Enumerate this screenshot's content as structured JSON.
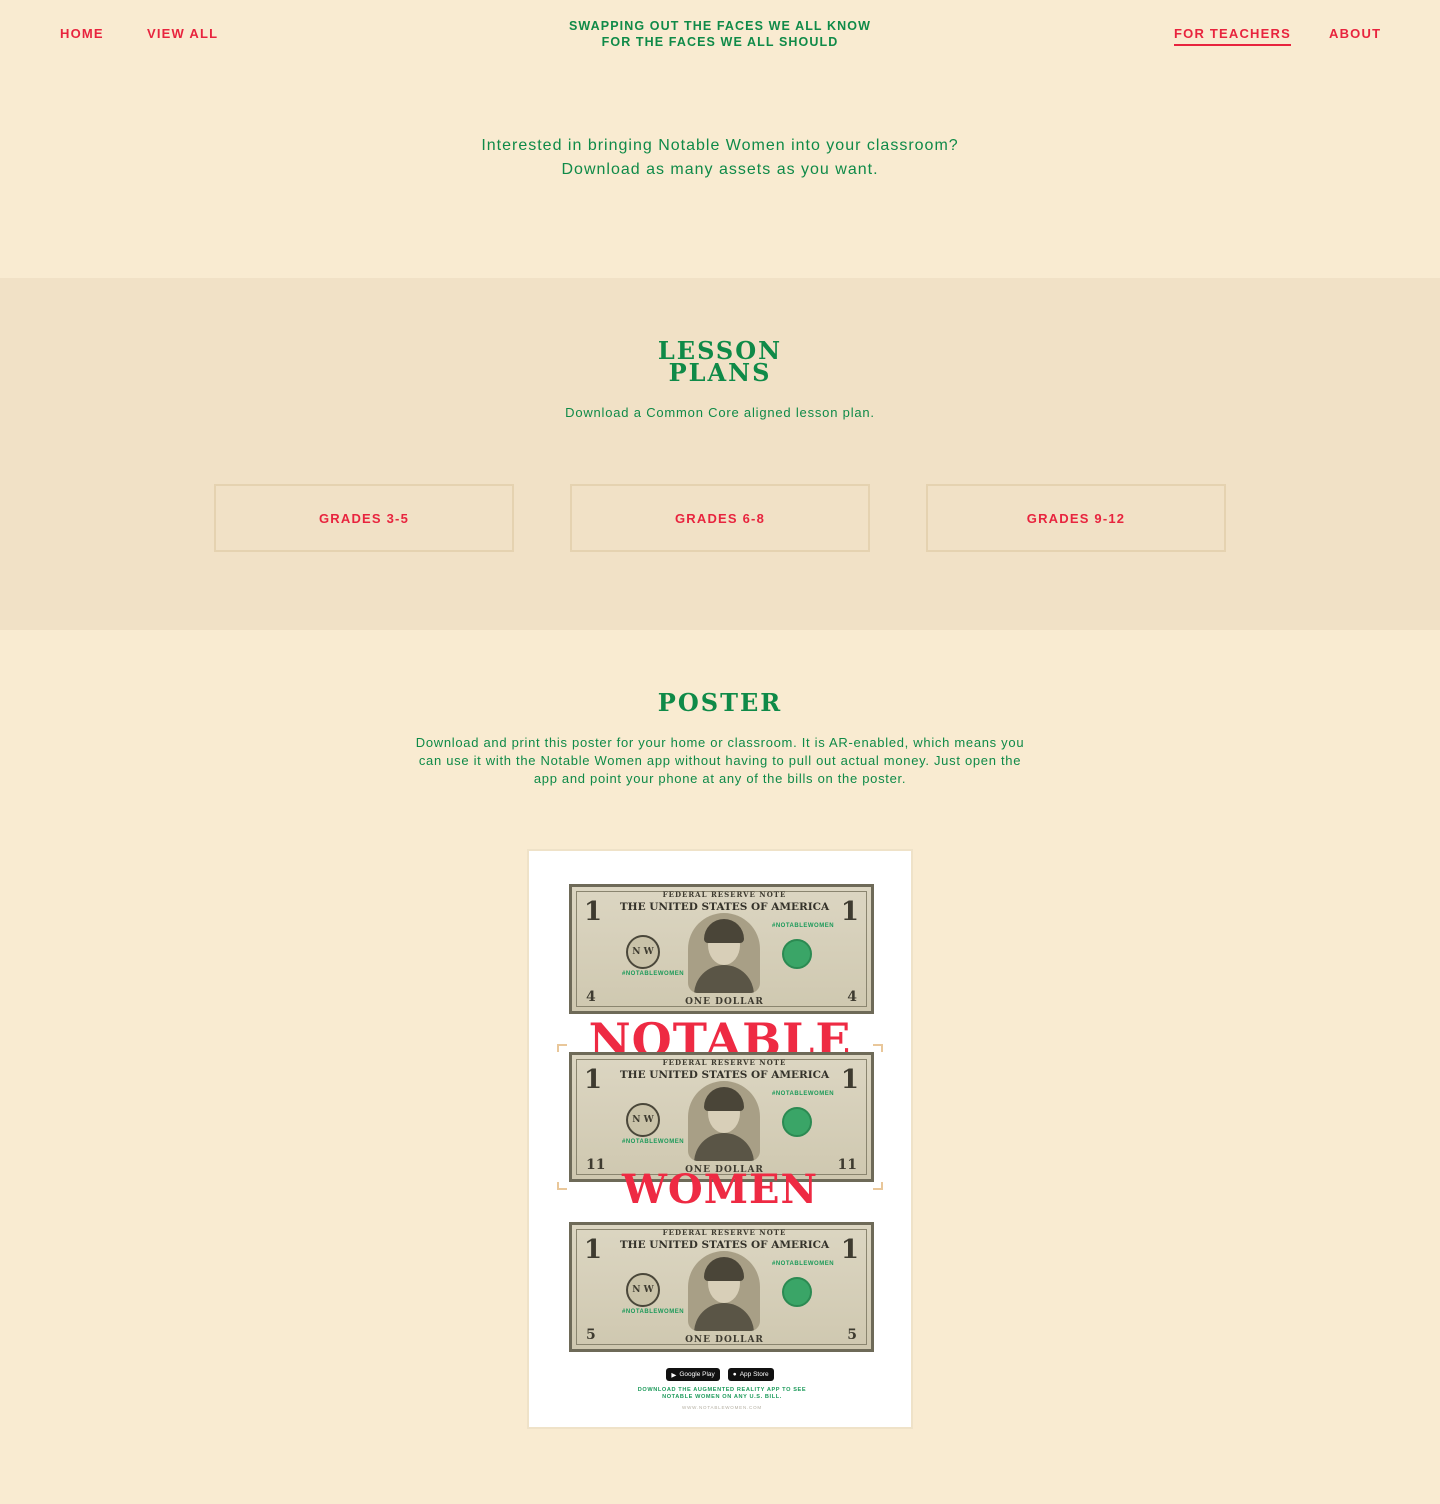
{
  "nav": {
    "home": "HOME",
    "view_all": "VIEW ALL",
    "tagline_line1": "SWAPPING OUT THE FACES WE ALL KNOW",
    "tagline_line2": "FOR THE FACES WE ALL SHOULD",
    "for_teachers": "FOR TEACHERS",
    "about": "ABOUT",
    "active": "FOR TEACHERS"
  },
  "intro": {
    "line1": "Interested in bringing Notable Women into your classroom?",
    "line2": "Download as many assets as you want."
  },
  "lesson_plans": {
    "heading_line1": "LESSON",
    "heading_line2": "PLANS",
    "subtitle": "Download a Common Core aligned lesson plan.",
    "buttons": [
      "GRADES 3-5",
      "GRADES 6-8",
      "GRADES 9-12"
    ]
  },
  "poster": {
    "heading": "POSTER",
    "description_line1": "Download and print this poster for your home or classroom. It is AR-enabled, which means you",
    "description_line2": "can use it with the Notable Women app without having to pull out actual money. Just open the",
    "description_line3": "app and point your phone at any of the bills on the poster.",
    "image": {
      "bill_top_line": "FEDERAL RESERVE NOTE",
      "bill_title": "THE UNITED STATES OF AMERICA",
      "bill_hashtag": "#NOTABLEWOMEN",
      "bill_seal": "N W",
      "bill_denomination": "ONE DOLLAR",
      "bill_number": "1",
      "bills": [
        {
          "serial": "4"
        },
        {
          "serial": "11"
        },
        {
          "serial": "5"
        }
      ],
      "title_top": "NOTABLE",
      "title_bottom": "WOMEN",
      "google_play": "Google Play",
      "app_store": "App Store",
      "footer_line1": "DOWNLOAD THE AUGMENTED REALITY APP TO SEE",
      "footer_line2": "NOTABLE WOMEN ON ANY U.S. BILL.",
      "url": "WWW.NOTABLEWOMEN.COM"
    }
  },
  "colors": {
    "background": "#f9ebd1",
    "section_band": "#f1e1c6",
    "green": "#0f8a48",
    "red": "#e8243e"
  }
}
